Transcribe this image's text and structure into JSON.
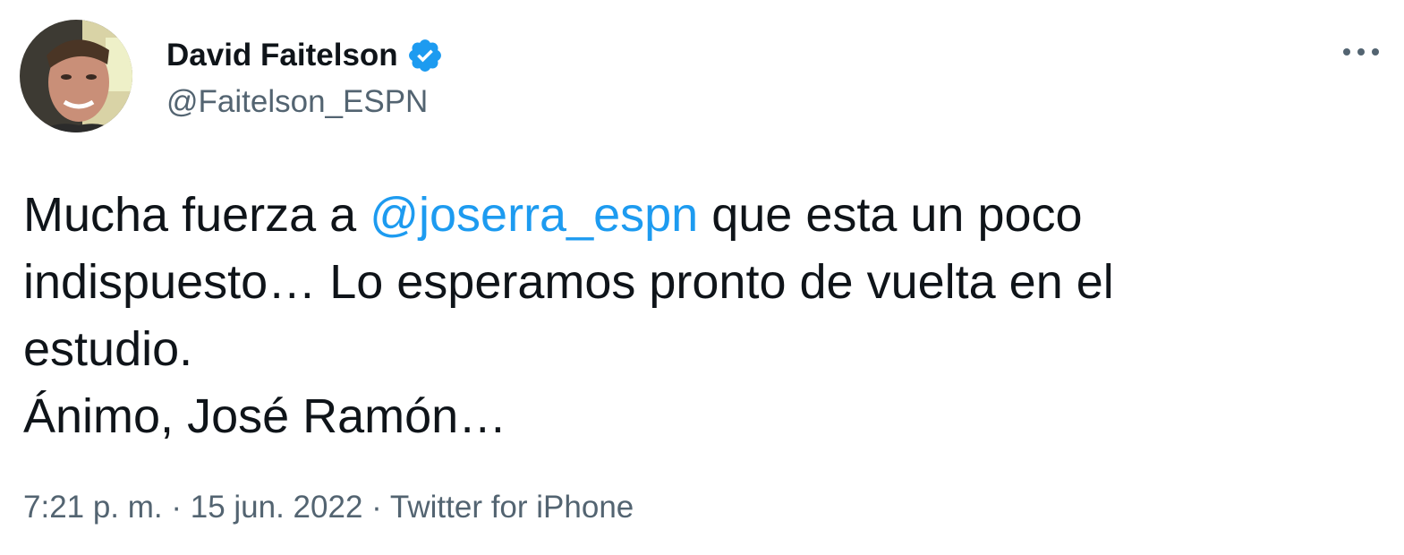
{
  "author": {
    "display_name": "David Faitelson",
    "handle": "@Faitelson_ESPN",
    "verified": true,
    "avatar_icon": "profile-photo"
  },
  "menu_icon": "more-options-icon",
  "tweet": {
    "text_before_mention": "Mucha fuerza a ",
    "mention": "@joserra_espn",
    "text_after_mention": " que esta un poco\nindispuesto… Lo esperamos pronto de vuelta en el\nestudio.\nÁnimo, José Ramón…"
  },
  "meta": {
    "time": "7:21 p. m.",
    "separator": " · ",
    "date": "15 jun. 2022",
    "source": "Twitter for iPhone"
  },
  "colors": {
    "text": "#0f1419",
    "secondary": "#536471",
    "link": "#1d9bf0",
    "verified_badge": "#1d9bf0"
  }
}
